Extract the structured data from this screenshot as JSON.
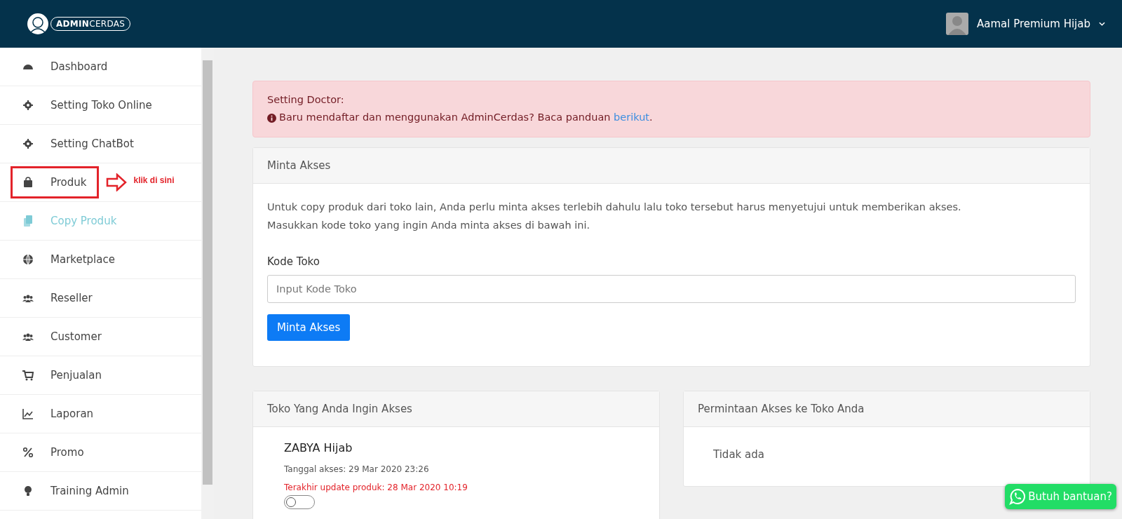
{
  "header": {
    "logo": "**ADMIN**CERDAS",
    "user_name": "Aamal Premium Hijab"
  },
  "sidebar": {
    "items": [
      {
        "label": "Dashboard",
        "selected": false,
        "highlighted": false
      },
      {
        "label": "Setting Toko Online",
        "selected": false,
        "highlighted": false
      },
      {
        "label": "Setting ChatBot",
        "selected": false,
        "highlighted": false
      },
      {
        "label": "Produk",
        "selected": false,
        "highlighted": true
      },
      {
        "label": "Copy Produk",
        "selected": true,
        "highlighted": false
      },
      {
        "label": "Marketplace",
        "selected": false,
        "highlighted": false
      },
      {
        "label": "Reseller",
        "selected": false,
        "highlighted": false
      },
      {
        "label": "Customer",
        "selected": false,
        "highlighted": false
      },
      {
        "label": "Penjualan",
        "selected": false,
        "highlighted": false
      },
      {
        "label": "Laporan",
        "selected": false,
        "highlighted": false
      },
      {
        "label": "Promo",
        "selected": false,
        "highlighted": false
      },
      {
        "label": "Training Admin",
        "selected": false,
        "highlighted": false
      }
    ]
  },
  "annotation": {
    "text": "klik di sini"
  },
  "alert": {
    "title": "Setting Doctor:",
    "message": "Baru mendaftar dan menggunakan AdminCerdas? Baca panduan",
    "link": "berikut",
    "end": "."
  },
  "request_card": {
    "title": "Minta Akses",
    "lines": [
      "Untuk copy produk dari toko lain, Anda perlu minta akses terlebih dahulu lalu toko tersebut harus menyetujui untuk memberikan akses.",
      "Masukkan kode toko yang ingin Anda minta akses di bawah ini."
    ],
    "field_label": "Kode Toko",
    "placeholder": "Input Kode Toko",
    "button": "Minta Akses"
  },
  "stores_card": {
    "title": "Toko Yang Anda Ingin Akses",
    "stores": [
      {
        "name": "ZABYA Hijab",
        "access_date": "Tanggal akses: 29 Mar 2020 23:26",
        "last_update": "Terakhir update produk: 28 Mar 2020 10:19",
        "on": false
      }
    ]
  },
  "requests_card": {
    "title": "Permintaan Akses ke Toko Anda",
    "empty": "Tidak ada"
  },
  "help_button": {
    "label": "Butuh bantuan?"
  }
}
